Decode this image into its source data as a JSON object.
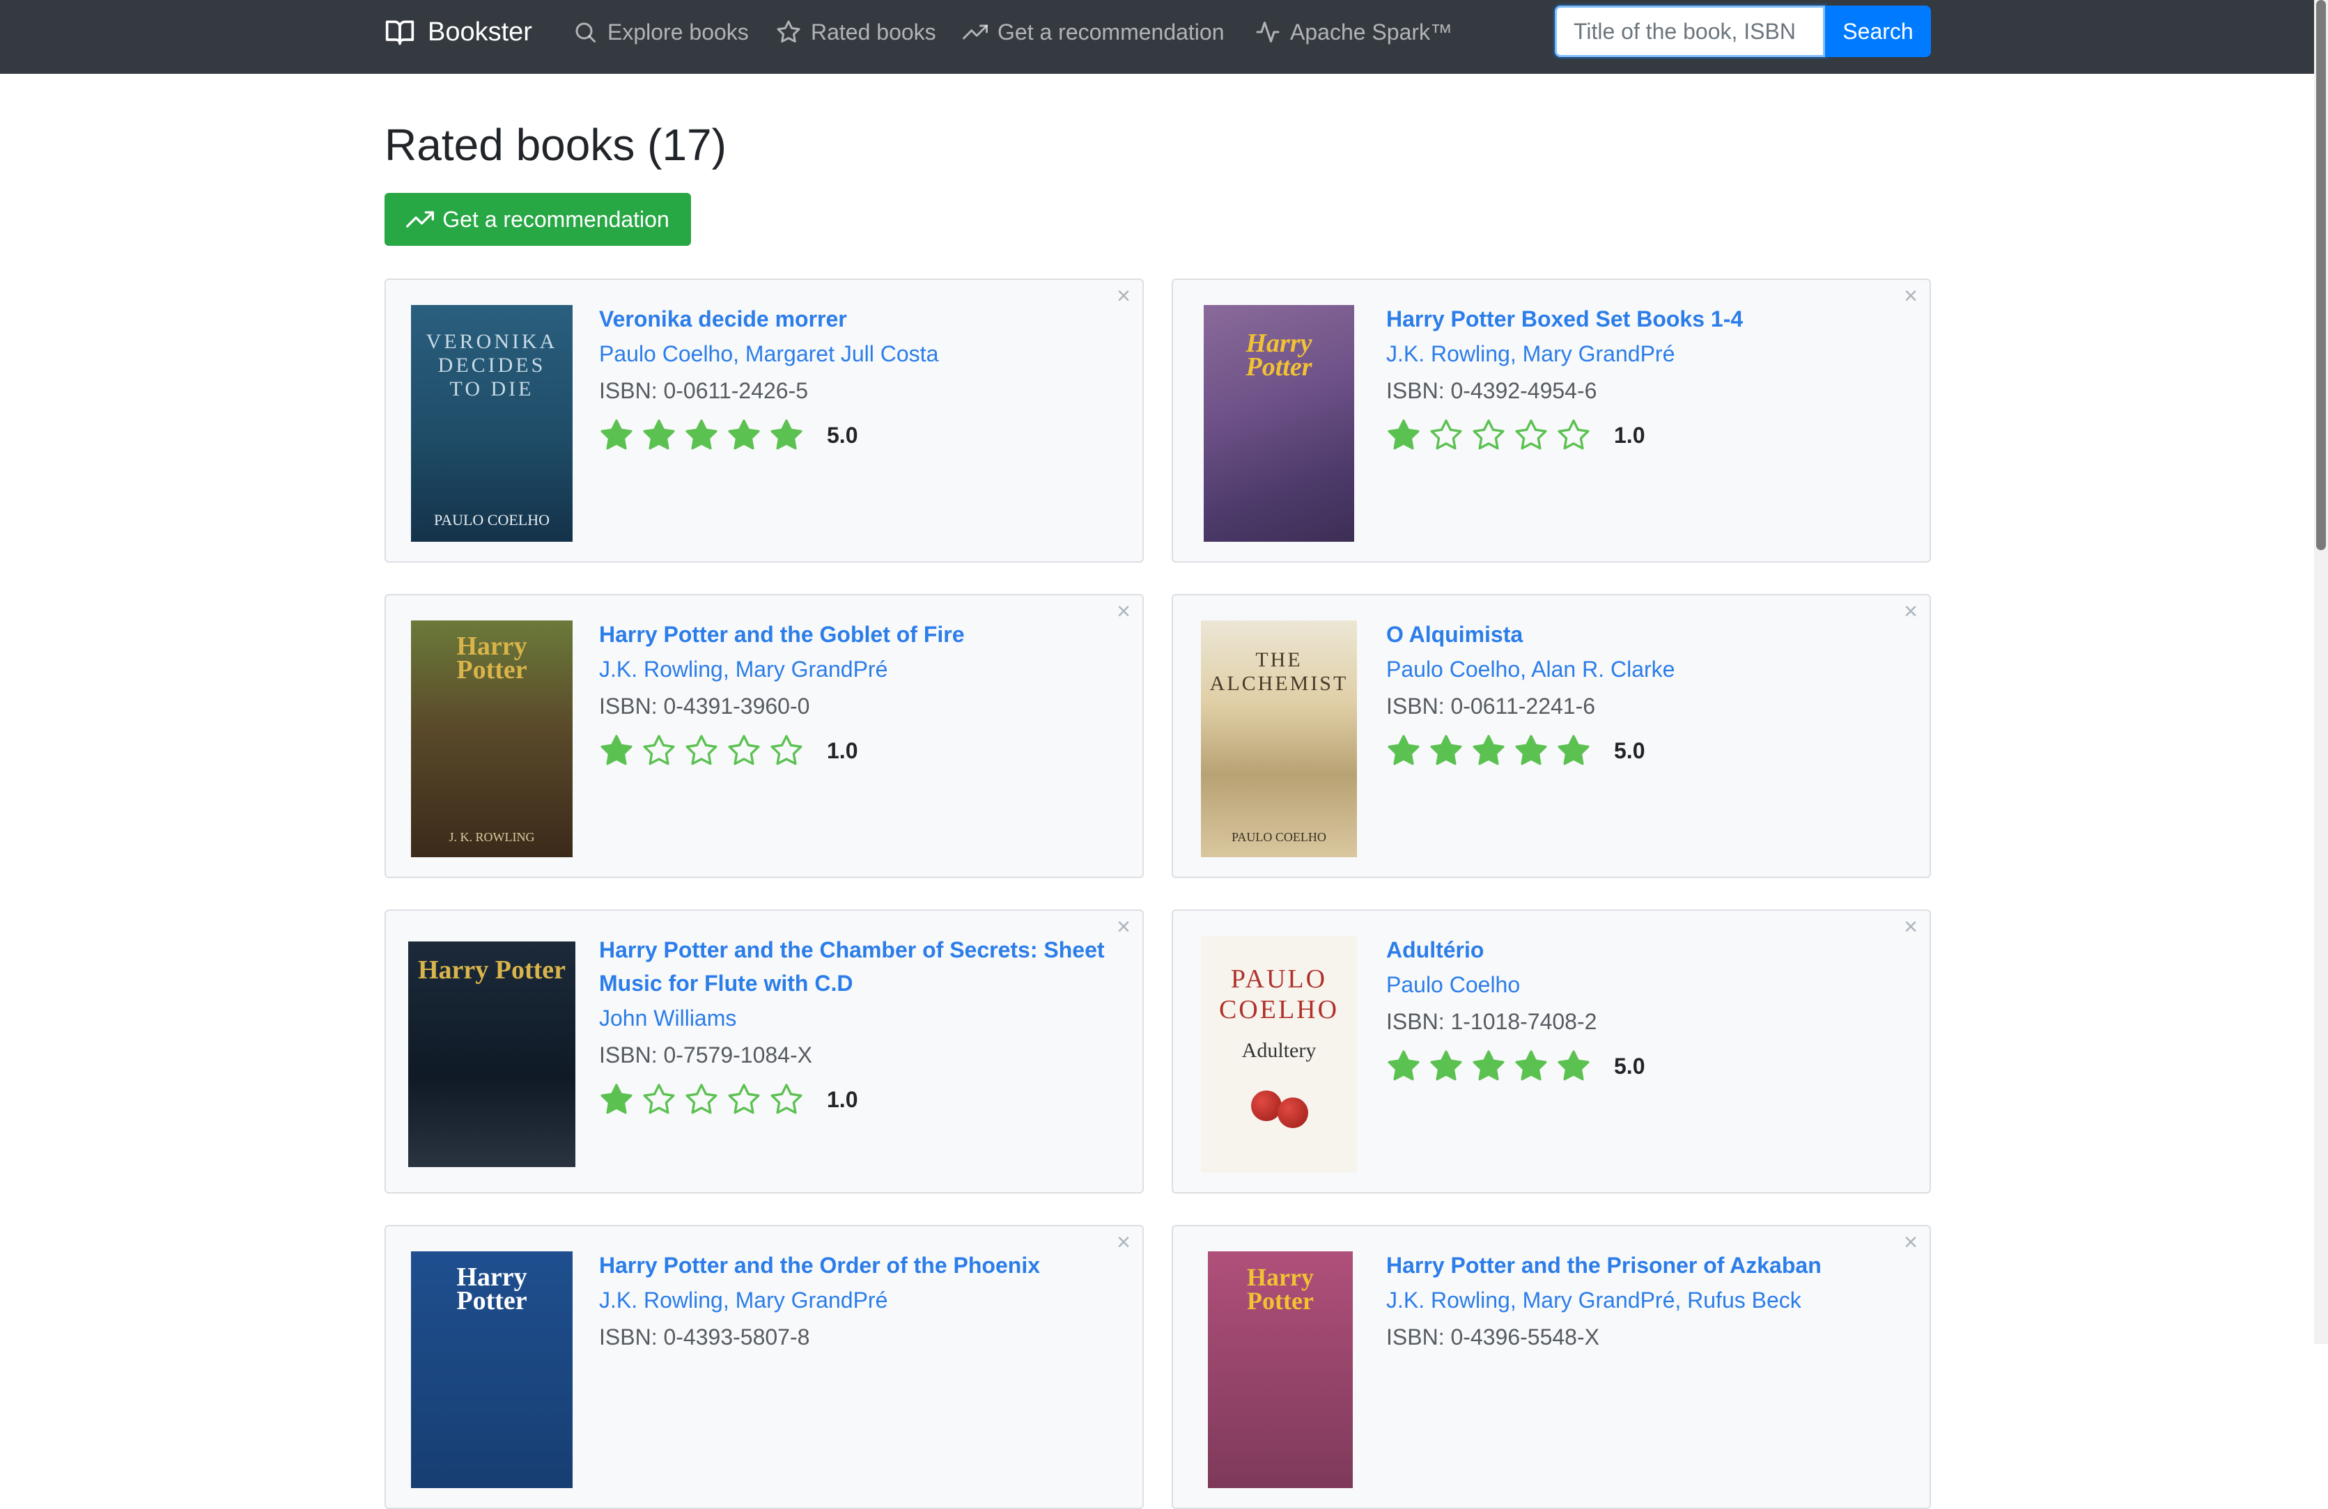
{
  "navbar": {
    "brand": "Bookster",
    "links": [
      {
        "label": "Explore books",
        "icon": "search-icon"
      },
      {
        "label": "Rated books",
        "icon": "star-icon"
      },
      {
        "label": "Get a recommendation",
        "icon": "trending-up-icon"
      },
      {
        "label": "Apache Spark™",
        "icon": "activity-icon"
      }
    ],
    "search": {
      "placeholder": "Title of the book, ISBN",
      "button_label": "Search"
    }
  },
  "page": {
    "title": "Rated books (17)",
    "recommend_button": "Get a recommendation"
  },
  "colors": {
    "navbar": "#343a40",
    "link": "#2b7de9",
    "star": "#5bc151",
    "primary": "#007bff",
    "success": "#28a745"
  },
  "books": [
    {
      "title": "Veronika decide morrer",
      "authors": "Paulo Coelho, Margaret Jull Costa",
      "isbn": "ISBN: 0-0611-2426-5",
      "rating": 5,
      "rating_label": "5.0",
      "cover_text": "VERONIKA DECIDES TO DIE",
      "cover_author": "PAULO COELHO"
    },
    {
      "title": "Harry Potter Boxed Set Books 1-4",
      "authors": "J.K. Rowling, Mary GrandPré",
      "isbn": "ISBN: 0-4392-4954-6",
      "rating": 1,
      "rating_label": "1.0",
      "cover_text": "Harry Potter",
      "cover_author": ""
    },
    {
      "title": "Harry Potter and the Goblet of Fire",
      "authors": "J.K. Rowling, Mary GrandPré",
      "isbn": "ISBN: 0-4391-3960-0",
      "rating": 1,
      "rating_label": "1.0",
      "cover_text": "Harry Potter",
      "cover_author": "J. K. ROWLING"
    },
    {
      "title": "O Alquimista",
      "authors": "Paulo Coelho, Alan R. Clarke",
      "isbn": "ISBN: 0-0611-2241-6",
      "rating": 5,
      "rating_label": "5.0",
      "cover_text": "THE ALCHEMIST",
      "cover_author": "PAULO COELHO"
    },
    {
      "title": "Harry Potter and the Chamber of Secrets: Sheet Music for Flute with C.D",
      "authors": "John Williams",
      "isbn": "ISBN: 0-7579-1084-X",
      "rating": 1,
      "rating_label": "1.0",
      "cover_text": "Harry Potter",
      "cover_author": ""
    },
    {
      "title": "Adultério",
      "authors": "Paulo Coelho",
      "isbn": "ISBN: 1-1018-7408-2",
      "rating": 5,
      "rating_label": "5.0",
      "cover_text": "PAULO COELHO",
      "cover_author": "Adultery"
    },
    {
      "title": "Harry Potter and the Order of the Phoenix",
      "authors": "J.K. Rowling, Mary GrandPré",
      "isbn": "ISBN: 0-4393-5807-8",
      "rating": null,
      "rating_label": "",
      "cover_text": "Harry Potter",
      "cover_author": ""
    },
    {
      "title": "Harry Potter and the Prisoner of Azkaban",
      "authors": "J.K. Rowling, Mary GrandPré, Rufus Beck",
      "isbn": "ISBN: 0-4396-5548-X",
      "rating": null,
      "rating_label": "",
      "cover_text": "Harry Potter",
      "cover_author": ""
    }
  ]
}
